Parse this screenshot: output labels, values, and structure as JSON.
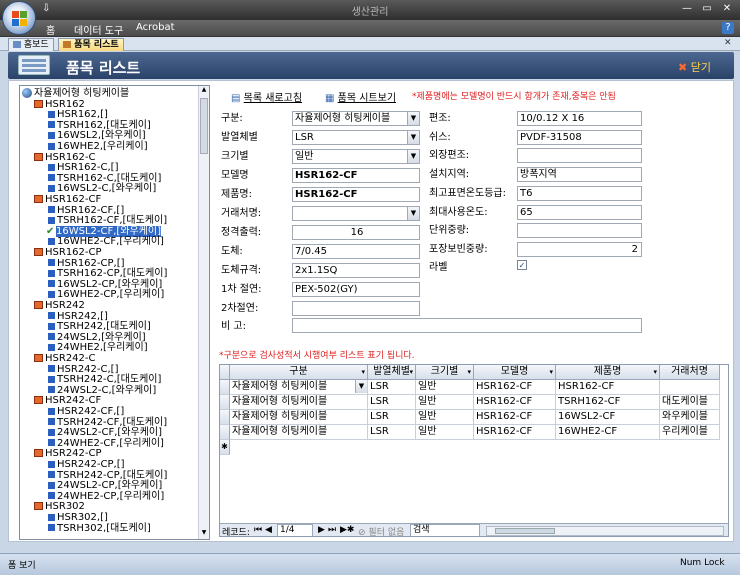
{
  "window": {
    "title": "생산관리",
    "quick_access": "⇩",
    "controls": {
      "minimize": "—",
      "restore": "▭",
      "close": "✕"
    }
  },
  "ribbon": {
    "tabs": [
      "홈",
      "데이터 도구",
      "Acrobat"
    ],
    "help": "?"
  },
  "doc_tabs": [
    {
      "label": "홈보드",
      "active": false
    },
    {
      "label": "품목 리스트",
      "active": true
    }
  ],
  "doc_close": "✕",
  "form": {
    "title": "품목 리스트",
    "close_label": "닫기"
  },
  "toolbar": {
    "refresh_label": "목록 새로고침",
    "sheet_label": "품목 시트보기",
    "notice": "*제품명에는 모델명이 반드시 항개가 존재,중복은 안됨"
  },
  "tree": {
    "root": "자율제어형 히팅케이블",
    "items": [
      {
        "type": "folder",
        "label": "HSR162"
      },
      {
        "type": "leaf",
        "label": "HSR162,[]"
      },
      {
        "type": "leaf",
        "label": "TSRH162,[대도케이]"
      },
      {
        "type": "leaf",
        "label": "16WSL2,[와우케이]"
      },
      {
        "type": "leaf",
        "label": "16WHE2,[우리케이]"
      },
      {
        "type": "folder",
        "label": "HSR162-C"
      },
      {
        "type": "leaf",
        "label": "HSR162-C,[]"
      },
      {
        "type": "leaf",
        "label": "TSRH162-C,[대도케이]"
      },
      {
        "type": "leaf",
        "label": "16WSL2-C,[와우케이]"
      },
      {
        "type": "folder",
        "label": "HSR162-CF"
      },
      {
        "type": "leaf",
        "label": "HSR162-CF,[]"
      },
      {
        "type": "leaf",
        "label": "TSRH162-CF,[대도케이]"
      },
      {
        "type": "checked",
        "label": "16WSL2-CF,[와우케이]"
      },
      {
        "type": "leaf",
        "label": "16WHE2-CF,[우리케이]"
      },
      {
        "type": "folder",
        "label": "HSR162-CP"
      },
      {
        "type": "leaf",
        "label": "HSR162-CP,[]"
      },
      {
        "type": "leaf",
        "label": "TSRH162-CP,[대도케이]"
      },
      {
        "type": "leaf",
        "label": "16WSL2-CP,[와우케이]"
      },
      {
        "type": "leaf",
        "label": "16WHE2-CP,[우리케이]"
      },
      {
        "type": "folder",
        "label": "HSR242"
      },
      {
        "type": "leaf",
        "label": "HSR242,[]"
      },
      {
        "type": "leaf",
        "label": "TSRH242,[대도케이]"
      },
      {
        "type": "leaf",
        "label": "24WSL2,[와우케이]"
      },
      {
        "type": "leaf",
        "label": "24WHE2,[우리케이]"
      },
      {
        "type": "folder",
        "label": "HSR242-C"
      },
      {
        "type": "leaf",
        "label": "HSR242-C,[]"
      },
      {
        "type": "leaf",
        "label": "TSRH242-C,[대도케이]"
      },
      {
        "type": "leaf",
        "label": "24WSL2-C,[와우케이]"
      },
      {
        "type": "folder",
        "label": "HSR242-CF"
      },
      {
        "type": "leaf",
        "label": "HSR242-CF,[]"
      },
      {
        "type": "leaf",
        "label": "TSRH242-CF,[대도케이]"
      },
      {
        "type": "leaf",
        "label": "24WSL2-CF,[와우케이]"
      },
      {
        "type": "leaf",
        "label": "24WHE2-CF,[우리케이]"
      },
      {
        "type": "folder",
        "label": "HSR242-CP"
      },
      {
        "type": "leaf",
        "label": "HSR242-CP,[]"
      },
      {
        "type": "leaf",
        "label": "TSRH242-CP,[대도케이]"
      },
      {
        "type": "leaf",
        "label": "24WSL2-CP,[와우케이]"
      },
      {
        "type": "leaf",
        "label": "24WHE2-CP,[우리케이]"
      },
      {
        "type": "folder",
        "label": "HSR302"
      },
      {
        "type": "leaf",
        "label": "HSR302,[]"
      },
      {
        "type": "leaf",
        "label": "TSRH302,[대도케이]"
      }
    ]
  },
  "fields_left": [
    {
      "label": "구분:",
      "value": "자율제어형 히팅케이블",
      "kind": "dropdown"
    },
    {
      "label": "발열체별",
      "value": "LSR",
      "kind": "dropdown"
    },
    {
      "label": "크기별",
      "value": "일반",
      "kind": "dropdown"
    },
    {
      "label": "모델명",
      "value": "HSR162-CF",
      "kind": "bold"
    },
    {
      "label": "제품명:",
      "value": "HSR162-CF",
      "kind": "bold"
    },
    {
      "label": "거래처명:",
      "value": "",
      "kind": "dropdown"
    },
    {
      "label": "정격출력:",
      "value": "16",
      "kind": "center"
    },
    {
      "label": "도체:",
      "value": "7/0.45",
      "kind": "text"
    },
    {
      "label": "도체규격:",
      "value": "2x1.1SQ",
      "kind": "text"
    },
    {
      "label": "1차 절연:",
      "value": "PEX-502(GY)",
      "kind": "text"
    },
    {
      "label": "2차절연:",
      "value": "",
      "kind": "text"
    }
  ],
  "remark": {
    "label": "비 고:",
    "value": ""
  },
  "fields_right": [
    {
      "label": "편조:",
      "value": "10/0.12 X 16",
      "kind": "text"
    },
    {
      "label": "쉬스:",
      "value": "PVDF-31508",
      "kind": "text"
    },
    {
      "label": "외장편조:",
      "value": "",
      "kind": "text"
    },
    {
      "label": "설치지역:",
      "value": "방폭지역",
      "kind": "text"
    },
    {
      "label": "최고표면온도등급:",
      "value": "T6",
      "kind": "text"
    },
    {
      "label": "최대사용온도:",
      "value": "65",
      "kind": "text"
    },
    {
      "label": "단위중량:",
      "value": "",
      "kind": "text"
    },
    {
      "label": "포장보빈중량:",
      "value": "2",
      "kind": "right"
    }
  ],
  "label_field": {
    "label": "라벨",
    "checked": true
  },
  "grid_notice": "*구분으로 검사성적서 시행여부 리스트 표기 됩니다.",
  "grid": {
    "columns": [
      "구분",
      "발열체별",
      "크기별",
      "모델명",
      "제품명",
      "거래처명"
    ],
    "rows": [
      [
        "자율제어형 히팅케이블",
        "LSR",
        "일반",
        "HSR162-CF",
        "HSR162-CF",
        ""
      ],
      [
        "자율제어형 히팅케이블",
        "LSR",
        "일반",
        "HSR162-CF",
        "TSRH162-CF",
        "대도케이블"
      ],
      [
        "자율제어형 히팅케이블",
        "LSR",
        "일반",
        "HSR162-CF",
        "16WSL2-CF",
        "와우케이블"
      ],
      [
        "자율제어형 히팅케이블",
        "LSR",
        "일반",
        "HSR162-CF",
        "16WHE2-CF",
        "우리케이블"
      ]
    ],
    "new_row_marker": "✱"
  },
  "navigation": {
    "record_label": "레코드:",
    "position": "1/4",
    "filter_label": "필터 없음",
    "search_label": "검색"
  },
  "status": {
    "left": "폼 보기",
    "right": "Num Lock"
  },
  "colors": {
    "accent": "#2a4268",
    "notice_red": "#e02020",
    "selection": "#3169c6"
  }
}
